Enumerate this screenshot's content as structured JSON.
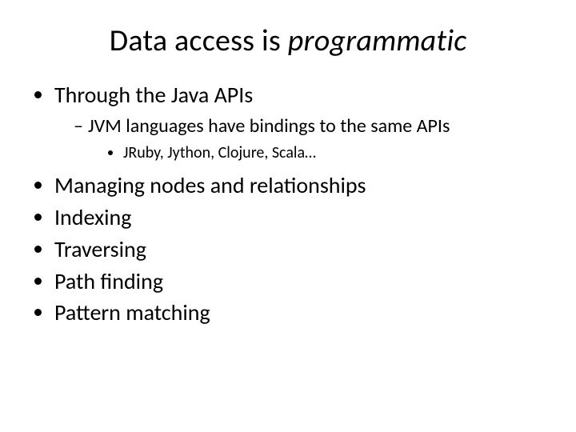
{
  "title_prefix": "Data access is ",
  "title_emph": "programmatic",
  "bullets": {
    "l1_0": "Through the Java APIs",
    "l2_0": "JVM languages have bindings to the same APIs",
    "l3_0": "JRuby, Jython, Clojure, Scala…",
    "l1_1": "Managing nodes and relationships",
    "l1_2": "Indexing",
    "l1_3": "Traversing",
    "l1_4": "Path finding",
    "l1_5": "Pattern matching"
  }
}
